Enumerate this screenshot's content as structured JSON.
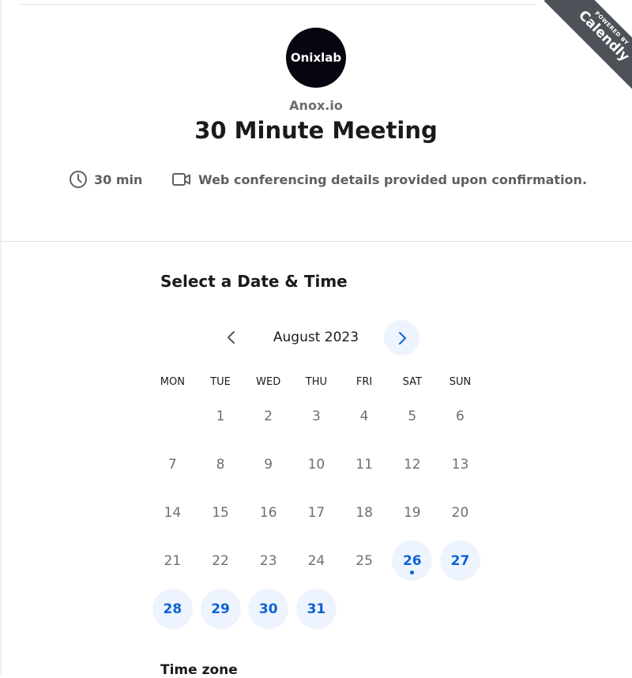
{
  "header": {
    "avatar_text": "Onixlab",
    "organization": "Anox.io",
    "title": "30 Minute Meeting",
    "duration": "30 min",
    "location_note": "Web conferencing details provided upon confirmation."
  },
  "ribbon": {
    "small": "POWERED BY",
    "big": "Calendly"
  },
  "calendar": {
    "section_title": "Select a Date & Time",
    "month_label": "August 2023",
    "weekdays": [
      "MON",
      "TUE",
      "WED",
      "THU",
      "FRI",
      "SAT",
      "SUN"
    ],
    "days": [
      {
        "d": "",
        "available": false
      },
      {
        "d": "1",
        "available": false
      },
      {
        "d": "2",
        "available": false
      },
      {
        "d": "3",
        "available": false
      },
      {
        "d": "4",
        "available": false
      },
      {
        "d": "5",
        "available": false
      },
      {
        "d": "6",
        "available": false
      },
      {
        "d": "7",
        "available": false
      },
      {
        "d": "8",
        "available": false
      },
      {
        "d": "9",
        "available": false
      },
      {
        "d": "10",
        "available": false
      },
      {
        "d": "11",
        "available": false
      },
      {
        "d": "12",
        "available": false
      },
      {
        "d": "13",
        "available": false
      },
      {
        "d": "14",
        "available": false
      },
      {
        "d": "15",
        "available": false
      },
      {
        "d": "16",
        "available": false
      },
      {
        "d": "17",
        "available": false
      },
      {
        "d": "18",
        "available": false
      },
      {
        "d": "19",
        "available": false
      },
      {
        "d": "20",
        "available": false
      },
      {
        "d": "21",
        "available": false
      },
      {
        "d": "22",
        "available": false
      },
      {
        "d": "23",
        "available": false
      },
      {
        "d": "24",
        "available": false
      },
      {
        "d": "25",
        "available": false
      },
      {
        "d": "26",
        "available": true,
        "today": true
      },
      {
        "d": "27",
        "available": true
      },
      {
        "d": "28",
        "available": true
      },
      {
        "d": "29",
        "available": true
      },
      {
        "d": "30",
        "available": true
      },
      {
        "d": "31",
        "available": true
      }
    ],
    "timezone_title": "Time zone"
  },
  "colors": {
    "accent": "#0a64d8",
    "accent_bg": "#eef4fe",
    "ribbon": "#4c5258"
  },
  "icons": {
    "duration": "clock-icon",
    "location": "video-camera-icon",
    "prev": "chevron-left-icon",
    "next": "chevron-right-icon"
  }
}
